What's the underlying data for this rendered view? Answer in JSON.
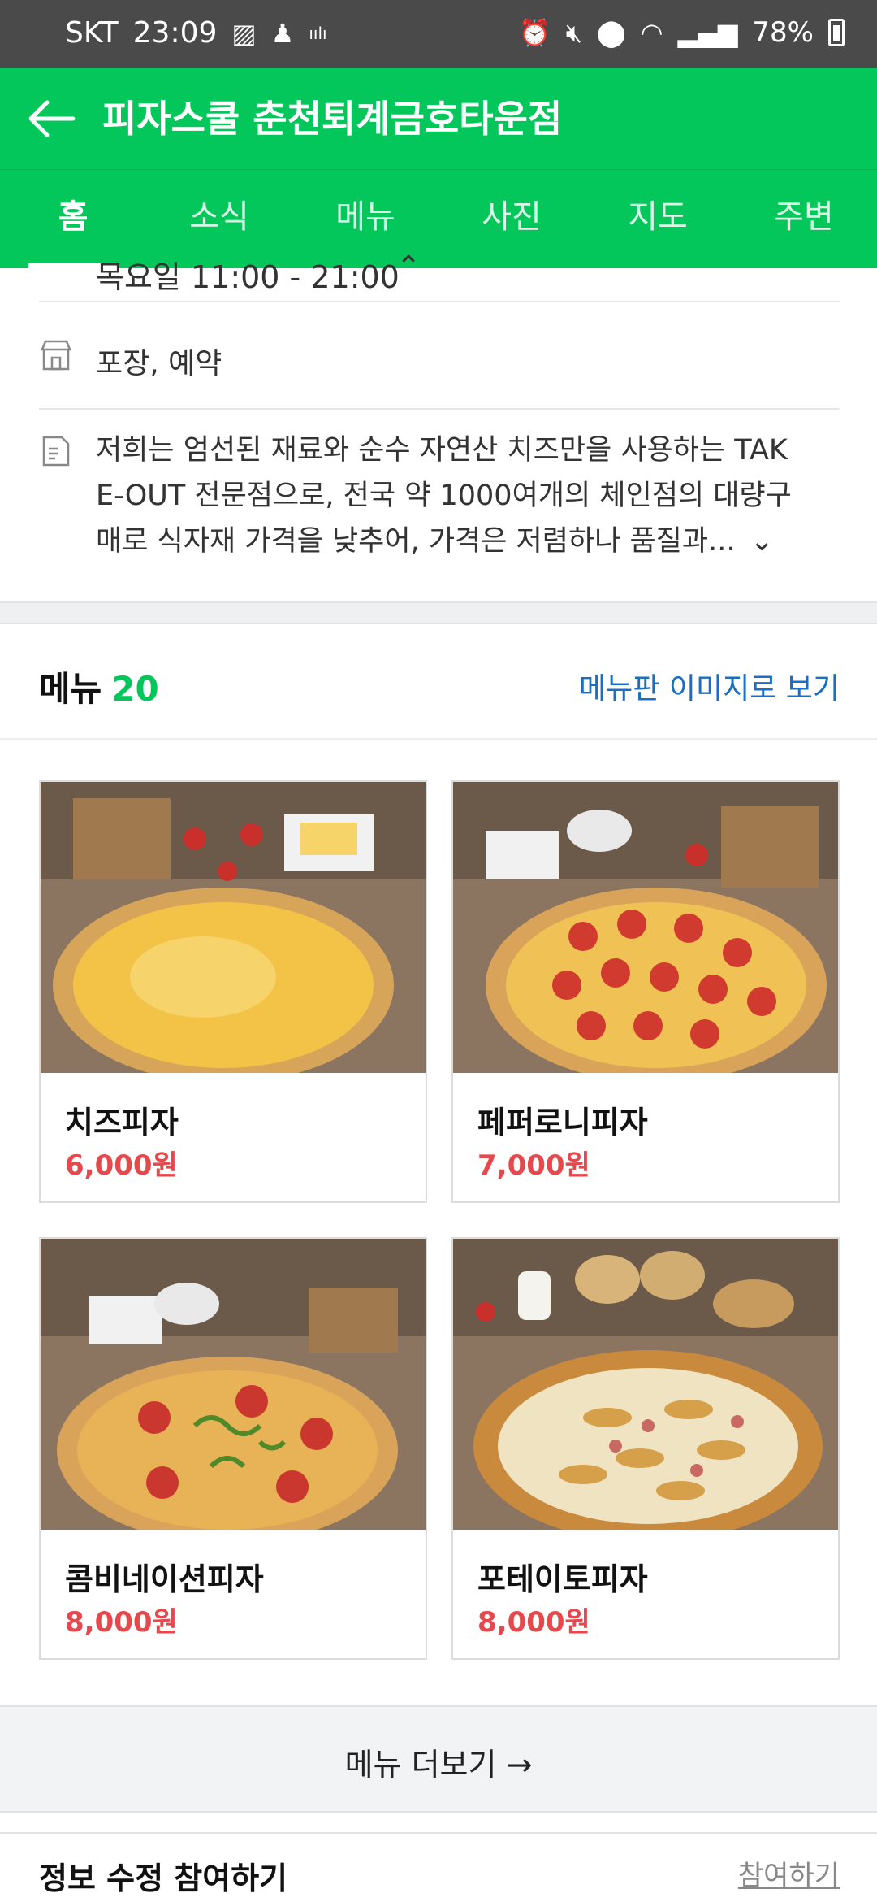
{
  "status_bar": {
    "carrier": "SKT",
    "time": "23:09",
    "battery": "78%"
  },
  "header": {
    "title": "피자스쿨 춘천퇴계금호타운점"
  },
  "tabs": [
    {
      "label": "홈",
      "active": true
    },
    {
      "label": "소식",
      "active": false
    },
    {
      "label": "메뉴",
      "active": false
    },
    {
      "label": "사진",
      "active": false
    },
    {
      "label": "지도",
      "active": false
    },
    {
      "label": "주변",
      "active": false
    }
  ],
  "info": {
    "hours": "목요일 11:00 - 21:00",
    "services": "포장, 예약",
    "description_lines": [
      "저희는 엄선된 재료와 순수 자연산 치즈만을 사용하는 TAK",
      "E-OUT 전문점으로, 전국 약 1000여개의 체인점의 대량구",
      "매로 식자재 가격을 낮추어, 가격은 저렴하나 품질과..."
    ]
  },
  "menu": {
    "title": "메뉴",
    "count": "20",
    "image_link": "메뉴판 이미지로 보기",
    "items": [
      {
        "name": "치즈피자",
        "price": "6,000원"
      },
      {
        "name": "페퍼로니피자",
        "price": "7,000원"
      },
      {
        "name": "콤비네이션피자",
        "price": "8,000원"
      },
      {
        "name": "포테이토피자",
        "price": "8,000원"
      }
    ],
    "more_label": "메뉴 더보기"
  },
  "footer": {
    "title": "정보 수정 참여하기",
    "link": "참여하기"
  },
  "colors": {
    "brand_green": "#03c75a",
    "price_red": "#e5484d",
    "link_blue": "#1a6fc2"
  }
}
